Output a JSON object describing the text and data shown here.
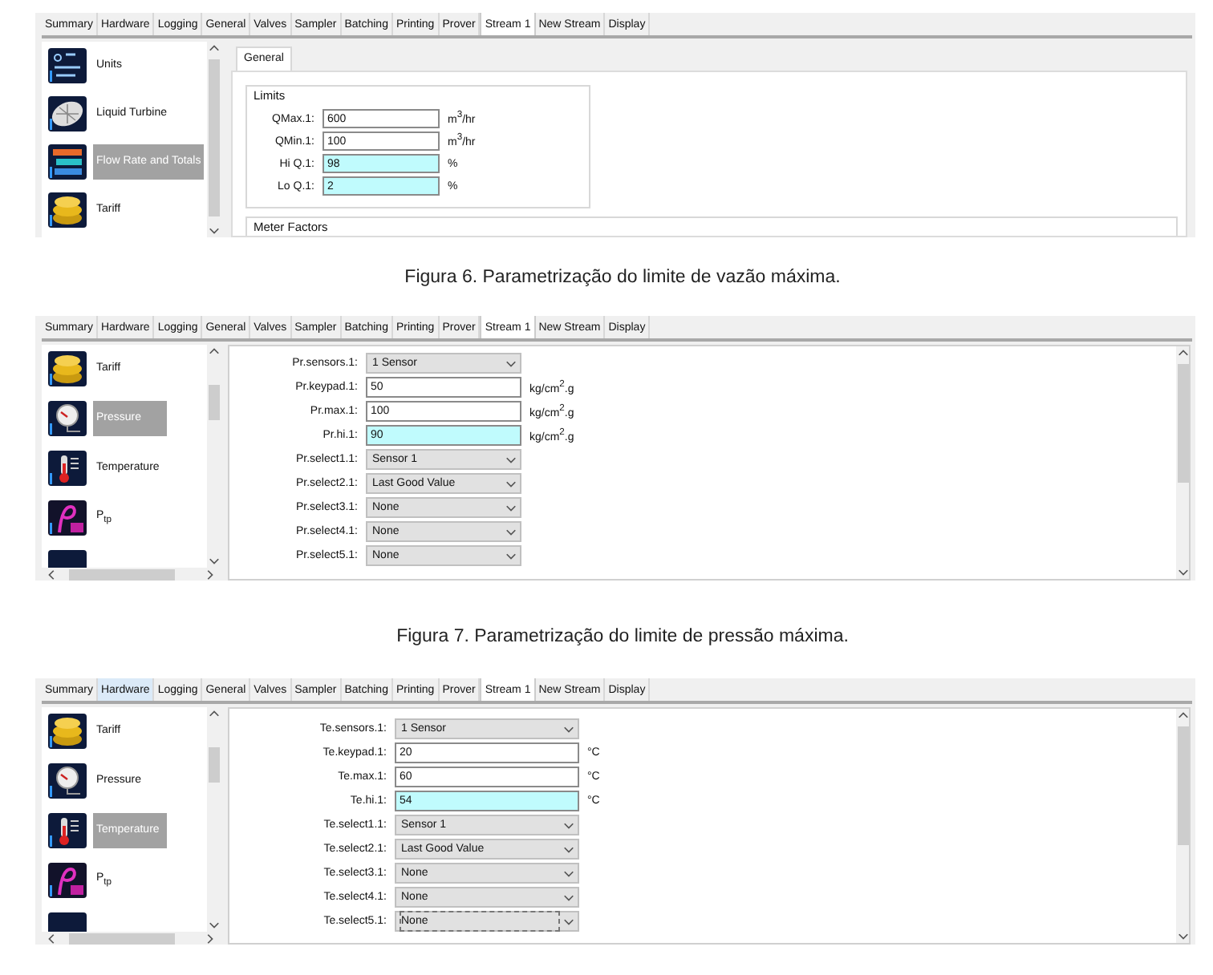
{
  "figures": [
    {
      "kind": "limits",
      "tabs": [
        {
          "label": "Summary",
          "selected": false,
          "hovered": false
        },
        {
          "label": "Hardware",
          "selected": false,
          "hovered": false
        },
        {
          "label": "Logging",
          "selected": false,
          "hovered": false
        },
        {
          "label": "General",
          "selected": false,
          "hovered": false
        },
        {
          "label": "Valves",
          "selected": false,
          "hovered": false
        },
        {
          "label": "Sampler",
          "selected": false,
          "hovered": false
        },
        {
          "label": "Batching",
          "selected": false,
          "hovered": false
        },
        {
          "label": "Printing",
          "selected": false,
          "hovered": false
        },
        {
          "label": "Prover",
          "selected": false,
          "hovered": false
        },
        {
          "label": "Stream 1",
          "selected": true,
          "hovered": false
        },
        {
          "label": "New Stream",
          "selected": false,
          "hovered": false
        },
        {
          "label": "Display",
          "selected": false,
          "hovered": false
        }
      ],
      "sidebar": {
        "items": [
          {
            "label": "Units",
            "kind": "units",
            "selected": false
          },
          {
            "label": "Liquid Turbine",
            "kind": "turbine",
            "selected": false
          },
          {
            "label": "Flow Rate and Totals",
            "kind": "flow",
            "selected": true
          },
          {
            "label": "Tariff",
            "kind": "tariff",
            "selected": false
          }
        ]
      },
      "inner_tabs": [
        {
          "label": "General",
          "selected": true
        }
      ],
      "groups": [
        {
          "title": "Limits",
          "fields": [
            {
              "label": "QMax.1:",
              "kind": "input",
              "value": "600",
              "unit": "m$^{3}$/hr",
              "highlighted": false
            },
            {
              "label": "QMin.1:",
              "kind": "input",
              "value": "100",
              "unit": "m$^{3}$/hr",
              "highlighted": false
            },
            {
              "label": "Hi Q.1:",
              "kind": "input",
              "value": "98",
              "unit": "%",
              "highlighted": true
            },
            {
              "label": "Lo Q.1:",
              "kind": "input",
              "value": "2",
              "unit": "%",
              "highlighted": true
            }
          ]
        },
        {
          "title": "Meter Factors"
        }
      ],
      "caption": "Figura 6. Parametrização do limite de vazão máxima."
    },
    {
      "kind": "form",
      "tabs": [
        {
          "label": "Summary",
          "selected": false,
          "hovered": false
        },
        {
          "label": "Hardware",
          "selected": false,
          "hovered": false
        },
        {
          "label": "Logging",
          "selected": false,
          "hovered": false
        },
        {
          "label": "General",
          "selected": false,
          "hovered": false
        },
        {
          "label": "Valves",
          "selected": false,
          "hovered": false
        },
        {
          "label": "Sampler",
          "selected": false,
          "hovered": false
        },
        {
          "label": "Batching",
          "selected": false,
          "hovered": false
        },
        {
          "label": "Printing",
          "selected": false,
          "hovered": false
        },
        {
          "label": "Prover",
          "selected": false,
          "hovered": false
        },
        {
          "label": "Stream 1",
          "selected": true,
          "hovered": false
        },
        {
          "label": "New Stream",
          "selected": false,
          "hovered": false
        },
        {
          "label": "Display",
          "selected": false,
          "hovered": false
        }
      ],
      "sidebar": {
        "items": [
          {
            "label": "Tariff",
            "kind": "tariff",
            "selected": false
          },
          {
            "label": "Pressure",
            "kind": "pressure",
            "selected": true
          },
          {
            "label": "Temperature",
            "kind": "temperature",
            "selected": false
          },
          {
            "label": "P$_{tp}$",
            "kind": "rho",
            "selected": false
          },
          {
            "kind": "blank"
          }
        ]
      },
      "fields": [
        {
          "label": "Pr.sensors.1:",
          "kind": "select",
          "value": "1 Sensor",
          "focused": false
        },
        {
          "label": "Pr.keypad.1:",
          "kind": "input",
          "value": "50",
          "unit": "kg/cm$^{2}$.g",
          "highlighted": false
        },
        {
          "label": "Pr.max.1:",
          "kind": "input",
          "value": "100",
          "unit": "kg/cm$^{2}$.g",
          "highlighted": false
        },
        {
          "label": "Pr.hi.1:",
          "kind": "input",
          "value": "90",
          "unit": "kg/cm$^{2}$.g",
          "highlighted": true
        },
        {
          "label": "Pr.select1.1:",
          "kind": "select",
          "value": "Sensor 1",
          "focused": false
        },
        {
          "label": "Pr.select2.1:",
          "kind": "select",
          "value": "Last Good Value",
          "focused": false
        },
        {
          "label": "Pr.select3.1:",
          "kind": "select",
          "value": "None",
          "focused": false
        },
        {
          "label": "Pr.select4.1:",
          "kind": "select",
          "value": "None",
          "focused": false
        },
        {
          "label": "Pr.select5.1:",
          "kind": "select",
          "value": "None",
          "focused": false
        }
      ],
      "caption": "Figura 7. Parametrização do limite de pressão máxima."
    },
    {
      "kind": "form",
      "tabs": [
        {
          "label": "Summary",
          "selected": false,
          "hovered": false
        },
        {
          "label": "Hardware",
          "selected": false,
          "hovered": true
        },
        {
          "label": "Logging",
          "selected": false,
          "hovered": false
        },
        {
          "label": "General",
          "selected": false,
          "hovered": false
        },
        {
          "label": "Valves",
          "selected": false,
          "hovered": false
        },
        {
          "label": "Sampler",
          "selected": false,
          "hovered": false
        },
        {
          "label": "Batching",
          "selected": false,
          "hovered": false
        },
        {
          "label": "Printing",
          "selected": false,
          "hovered": false
        },
        {
          "label": "Prover",
          "selected": false,
          "hovered": false
        },
        {
          "label": "Stream 1",
          "selected": true,
          "hovered": false
        },
        {
          "label": "New Stream",
          "selected": false,
          "hovered": false
        },
        {
          "label": "Display",
          "selected": false,
          "hovered": false
        }
      ],
      "sidebar": {
        "items": [
          {
            "label": "Tariff",
            "kind": "tariff",
            "selected": false
          },
          {
            "label": "Pressure",
            "kind": "pressure",
            "selected": false
          },
          {
            "label": "Temperature",
            "kind": "temperature",
            "selected": true
          },
          {
            "label": "P$_{tp}$",
            "kind": "rho",
            "selected": false
          },
          {
            "kind": "blank"
          }
        ]
      },
      "fields": [
        {
          "label": "Te.sensors.1:",
          "kind": "select",
          "value": "1 Sensor",
          "focused": false
        },
        {
          "label": "Te.keypad.1:",
          "kind": "input",
          "value": "20",
          "unit": "°C",
          "highlighted": false
        },
        {
          "label": "Te.max.1:",
          "kind": "input",
          "value": "60",
          "unit": "°C",
          "highlighted": false
        },
        {
          "label": "Te.hi.1:",
          "kind": "input",
          "value": "54",
          "unit": "°C",
          "highlighted": true
        },
        {
          "label": "Te.select1.1:",
          "kind": "select",
          "value": "Sensor 1",
          "focused": false
        },
        {
          "label": "Te.select2.1:",
          "kind": "select",
          "value": "Last Good Value",
          "focused": false
        },
        {
          "label": "Te.select3.1:",
          "kind": "select",
          "value": "None",
          "focused": false
        },
        {
          "label": "Te.select4.1:",
          "kind": "select",
          "value": "None",
          "focused": false
        },
        {
          "label": "Te.select5.1:",
          "kind": "select",
          "value": "None",
          "focused": true
        }
      ]
    }
  ]
}
